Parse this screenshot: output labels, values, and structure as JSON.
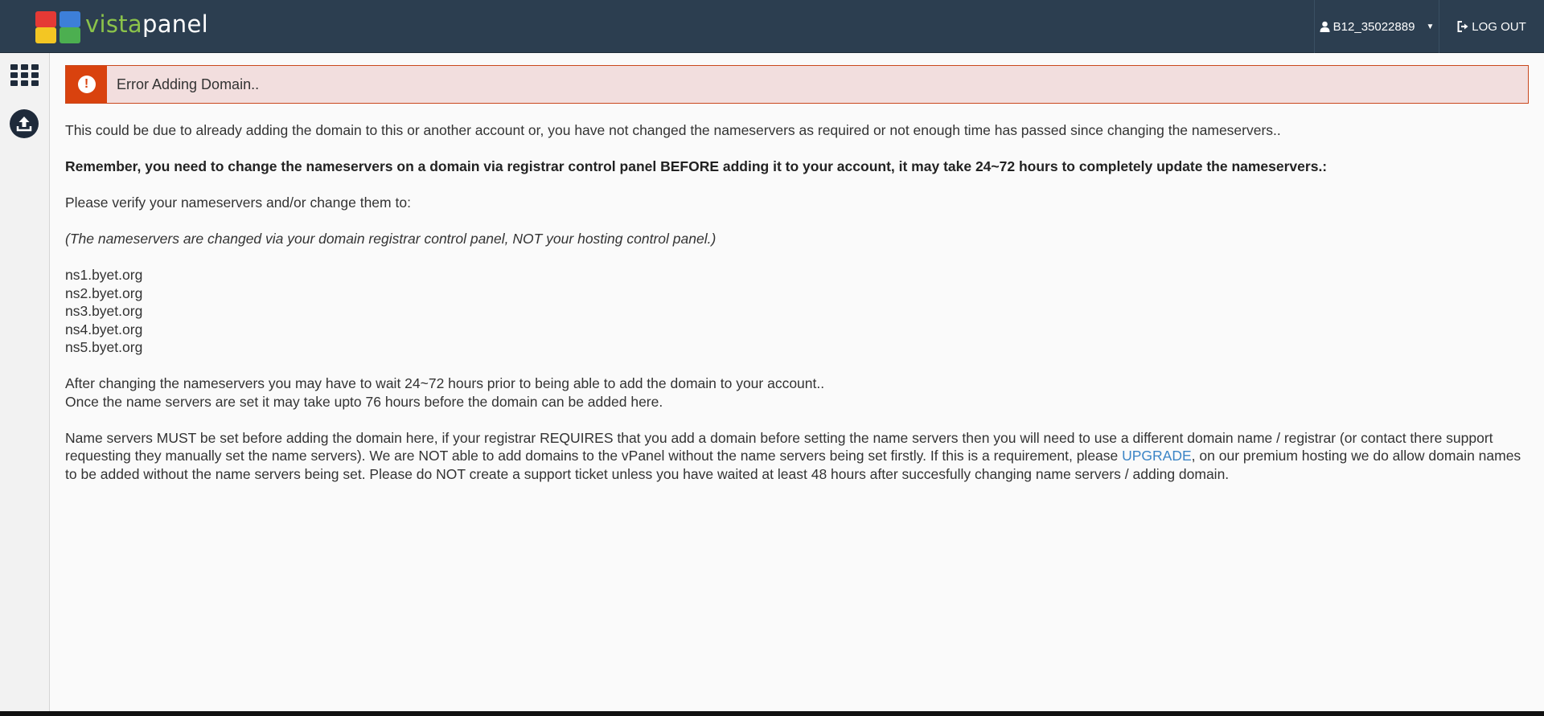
{
  "header": {
    "logo_vista": "vista",
    "logo_panel": "panel",
    "username": "B12_35022889",
    "logout_label": "LOG OUT"
  },
  "sidebar": {
    "icons": [
      "grid-icon",
      "upload-icon"
    ]
  },
  "alert": {
    "text": "Error Adding Domain..",
    "color": "#d9420e",
    "background": "#f2dede"
  },
  "content": {
    "p1": "This could be due to already adding the domain to this or another account or, you have not changed the nameservers as required or not enough time has passed since changing the nameservers..",
    "p2": "Remember, you need to change the nameservers on a domain via registrar control panel BEFORE adding it to your account, it may take 24~72 hours to completely update the nameservers.:",
    "p3": "Please verify your nameservers and/or change them to:",
    "p4": "(The nameservers are changed via your domain registrar control panel, NOT your hosting control panel.)",
    "nameservers": [
      "ns1.byet.org",
      "ns2.byet.org",
      "ns3.byet.org",
      "ns4.byet.org",
      "ns5.byet.org"
    ],
    "p5_line1": "After changing the nameservers you may have to wait 24~72 hours prior to being able to add the domain to your account..",
    "p5_line2": "Once the name servers are set it may take upto 76 hours before the domain can be added here.",
    "p6_before": "Name servers MUST be set before adding the domain here, if your registrar REQUIRES that you add a domain before setting the name servers then you will need to use a different domain name / registrar (or contact there support requesting they manually set the name servers). We are NOT able to add domains to the vPanel without the name servers being set firstly. If this is a requirement, please ",
    "p6_link": "UPGRADE",
    "p6_after": ", on our premium hosting we do allow domain names to be added without the name servers being set. Please do NOT create a support ticket unless you have waited at least 48 hours after succesfully changing name servers / adding domain."
  },
  "colors": {
    "topbar": "#2c3e50",
    "link": "#3a84c6"
  }
}
